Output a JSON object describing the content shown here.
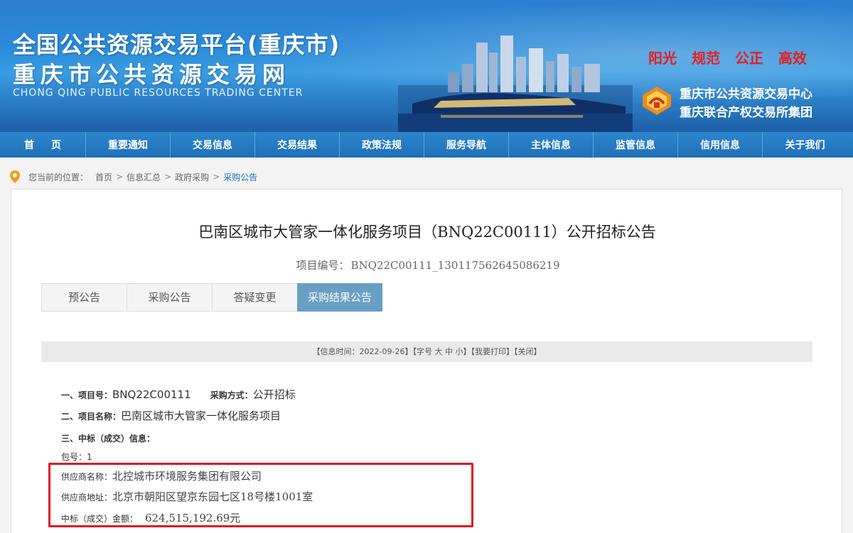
{
  "header": {
    "title_line1": "全国公共资源交易平台(重庆市)",
    "title_line2": "重庆市公共资源交易网",
    "title_en": "CHONG QING PUBLIC RESOURCES TRADING CENTER",
    "slogans": [
      "阳光",
      "规范",
      "公正",
      "高效"
    ],
    "org_line1": "重庆市公共资源交易中心",
    "org_line2": "重庆联合产权交易所集团",
    "slogan_color": "#e61e1e"
  },
  "nav": {
    "items": [
      "首页",
      "重要通知",
      "交易信息",
      "交易结果",
      "政策法规",
      "服务导航",
      "主体信息",
      "监管信息",
      "信用信息",
      "关于我们"
    ]
  },
  "breadcrumb": {
    "label": "您当前的位置：",
    "items": [
      "首页",
      "信息汇总",
      "政府采购",
      "采购公告"
    ],
    "separator": ">"
  },
  "document": {
    "title": "巴南区城市大管家一体化服务项目（BNQ22C00111）公开招标公告",
    "project_no_label": "项目编号：",
    "project_no": "BNQ22C00111_130117562645086219",
    "tabs": [
      "预公告",
      "采购公告",
      "答疑变更",
      "采购结果公告"
    ],
    "active_tab": "采购结果公告",
    "infobar": {
      "time": "【信息时间：2022-09-26】",
      "font_label": "【字号",
      "font_large": "大",
      "font_medium": "中",
      "font_small": "小】",
      "print": "【我要打印】",
      "close": "【关闭】"
    },
    "fields": {
      "item_no_label": "一、项目号：",
      "item_no": "BNQ22C00111",
      "method_label": "采购方式：",
      "method": "公开招标",
      "name_label": "二、项目名称：",
      "name": "巴南区城市大管家一体化服务项目",
      "result_label": "三、中标（成交）信息：",
      "package_label": "包号：",
      "package": "1",
      "supplier_label": "供应商名称：",
      "supplier": "北控城市环境服务集团有限公司",
      "address_label": "供应商地址：",
      "address": "北京市朝阳区望京东园七区18号楼1001室",
      "amount_label": "中标（成交）金额：",
      "amount": "624,515,192.69元"
    }
  },
  "colors": {
    "nav_bg": "#1f6fb6",
    "active_tab": "#6a9fc4",
    "link_current": "#1a6fb5",
    "highlight_border": "#e0161e"
  }
}
